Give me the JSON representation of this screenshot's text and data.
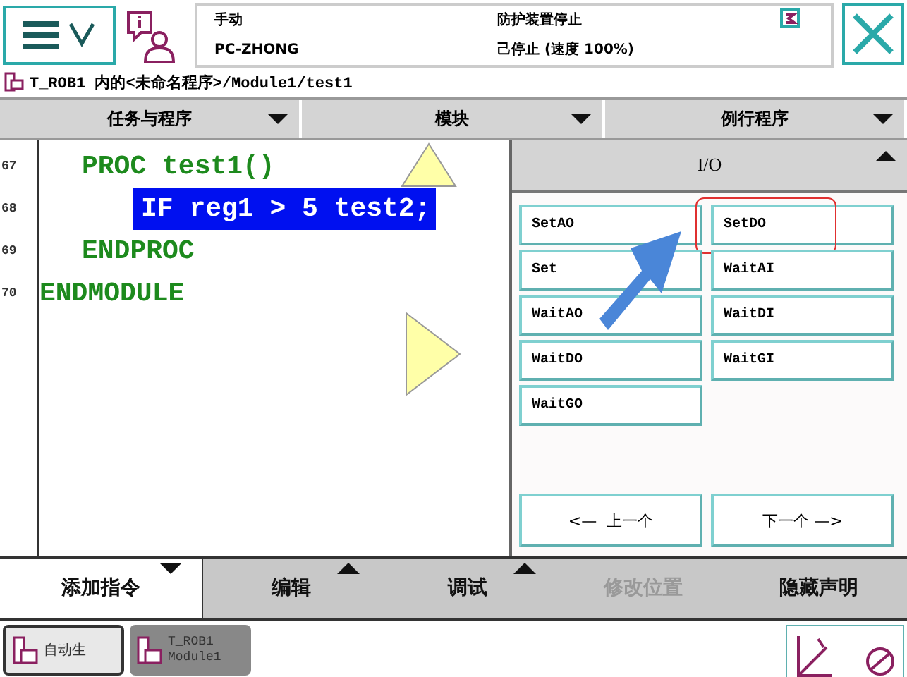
{
  "header": {
    "mode": "手动",
    "controller": "PC-ZHONG",
    "safety": "防护装置停止",
    "run_state": "己停止 (速度 100%)"
  },
  "path": "T_ROB1 内的<未命名程序>/Module1/test1",
  "menus": [
    "任务与程序",
    "模块",
    "例行程序"
  ],
  "code_lines": [
    {
      "number": "67",
      "text": "PROC test1()",
      "kind": "routine",
      "selected": false
    },
    {
      "number": "68",
      "text": "IF reg1 > 5 test2;",
      "kind": "statement",
      "selected": true
    },
    {
      "number": "69",
      "text": "ENDPROC",
      "kind": "routine",
      "selected": false
    },
    {
      "number": "70",
      "text": "ENDMODULE",
      "kind": "module",
      "selected": false
    }
  ],
  "io_panel": {
    "title": "I/O",
    "instructions": [
      {
        "label": "SetAO",
        "highlighted": false
      },
      {
        "label": "SetDO",
        "highlighted": true
      },
      {
        "label": "Set",
        "highlighted": false
      },
      {
        "label": "WaitAI",
        "highlighted": false
      },
      {
        "label": "WaitAO",
        "highlighted": false
      },
      {
        "label": "WaitDI",
        "highlighted": false
      },
      {
        "label": "WaitDO",
        "highlighted": false
      },
      {
        "label": "WaitGI",
        "highlighted": false
      },
      {
        "label": "WaitGO",
        "highlighted": false
      }
    ],
    "prev_button": "<—  上一个",
    "next_button": "下一个 —>"
  },
  "commands": [
    {
      "label": "添加指令",
      "selected": true,
      "disabled": false,
      "kind": "dropdown"
    },
    {
      "label": "编辑",
      "selected": false,
      "disabled": false,
      "kind": "popup"
    },
    {
      "label": "调试",
      "selected": false,
      "disabled": false,
      "kind": "popup"
    },
    {
      "label": "修改位置",
      "selected": false,
      "disabled": true,
      "kind": "action"
    },
    {
      "label": "隐藏声明",
      "selected": false,
      "disabled": false,
      "kind": "action"
    }
  ],
  "taskbar": [
    {
      "lines": [
        "自动生"
      ],
      "selected": true
    },
    {
      "lines": [
        "T_ROB1",
        "Module1"
      ],
      "selected": false
    }
  ]
}
